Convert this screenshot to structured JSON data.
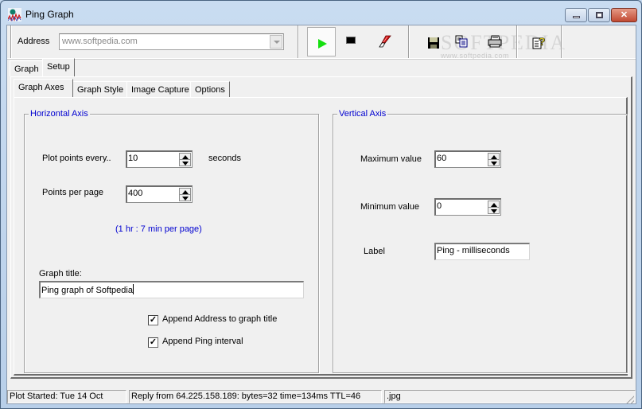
{
  "window": {
    "title": "Ping Graph",
    "controls": {
      "minimize": "minimize",
      "maximize": "maximize",
      "close": "close"
    }
  },
  "toolbar": {
    "address_label": "Address",
    "address_value": "www.softpedia.com",
    "buttons": [
      {
        "name": "start",
        "icon": "play-icon",
        "pressed": true
      },
      {
        "name": "stop",
        "icon": "stop-icon"
      },
      {
        "name": "clear",
        "icon": "eraser-icon"
      },
      {
        "name": "save",
        "icon": "floppy-disk-icon"
      },
      {
        "name": "copy",
        "icon": "copy-icon"
      },
      {
        "name": "print",
        "icon": "printer-icon"
      },
      {
        "name": "help",
        "icon": "help-icon"
      }
    ],
    "watermark": "www.softpedia.com",
    "watermark_brand": "SOFTPEDIA"
  },
  "tabs": {
    "outer": [
      {
        "label": "Graph",
        "active": false
      },
      {
        "label": "Setup",
        "active": true
      }
    ],
    "inner": [
      {
        "label": "Graph Axes",
        "active": true
      },
      {
        "label": "Graph Style",
        "active": false
      },
      {
        "label": "Image Capture",
        "active": false
      },
      {
        "label": "Options",
        "active": false
      }
    ]
  },
  "horizontal_axis": {
    "title": "Horizontal Axis",
    "plot_every_label": "Plot points every..",
    "plot_every_value": "10",
    "plot_every_unit": "seconds",
    "points_per_page_label": "Points per page",
    "points_per_page_value": "400",
    "duration_info": "(1 hr : 7 min per page)",
    "graph_title_label": "Graph title:",
    "graph_title_value": "Ping graph of Softpedia",
    "append_address_label": "Append Address to graph title",
    "append_address_checked": true,
    "append_interval_label": "Append Ping interval",
    "append_interval_checked": true
  },
  "vertical_axis": {
    "title": "Vertical Axis",
    "max_label": "Maximum value",
    "max_value": "60",
    "min_label": "Minimum value",
    "min_value": "0",
    "label_label": "Label",
    "label_value": "Ping - milliseconds"
  },
  "statusbar": {
    "plot_started": "Plot Started: Tue 14 Oct",
    "reply": "Reply from 64.225.158.189: bytes=32 time=134ms TTL=46",
    "format": ".jpg"
  },
  "colors": {
    "group_title": "#0000d0",
    "play_green": "#16e010",
    "background": "#f0f0f0"
  }
}
